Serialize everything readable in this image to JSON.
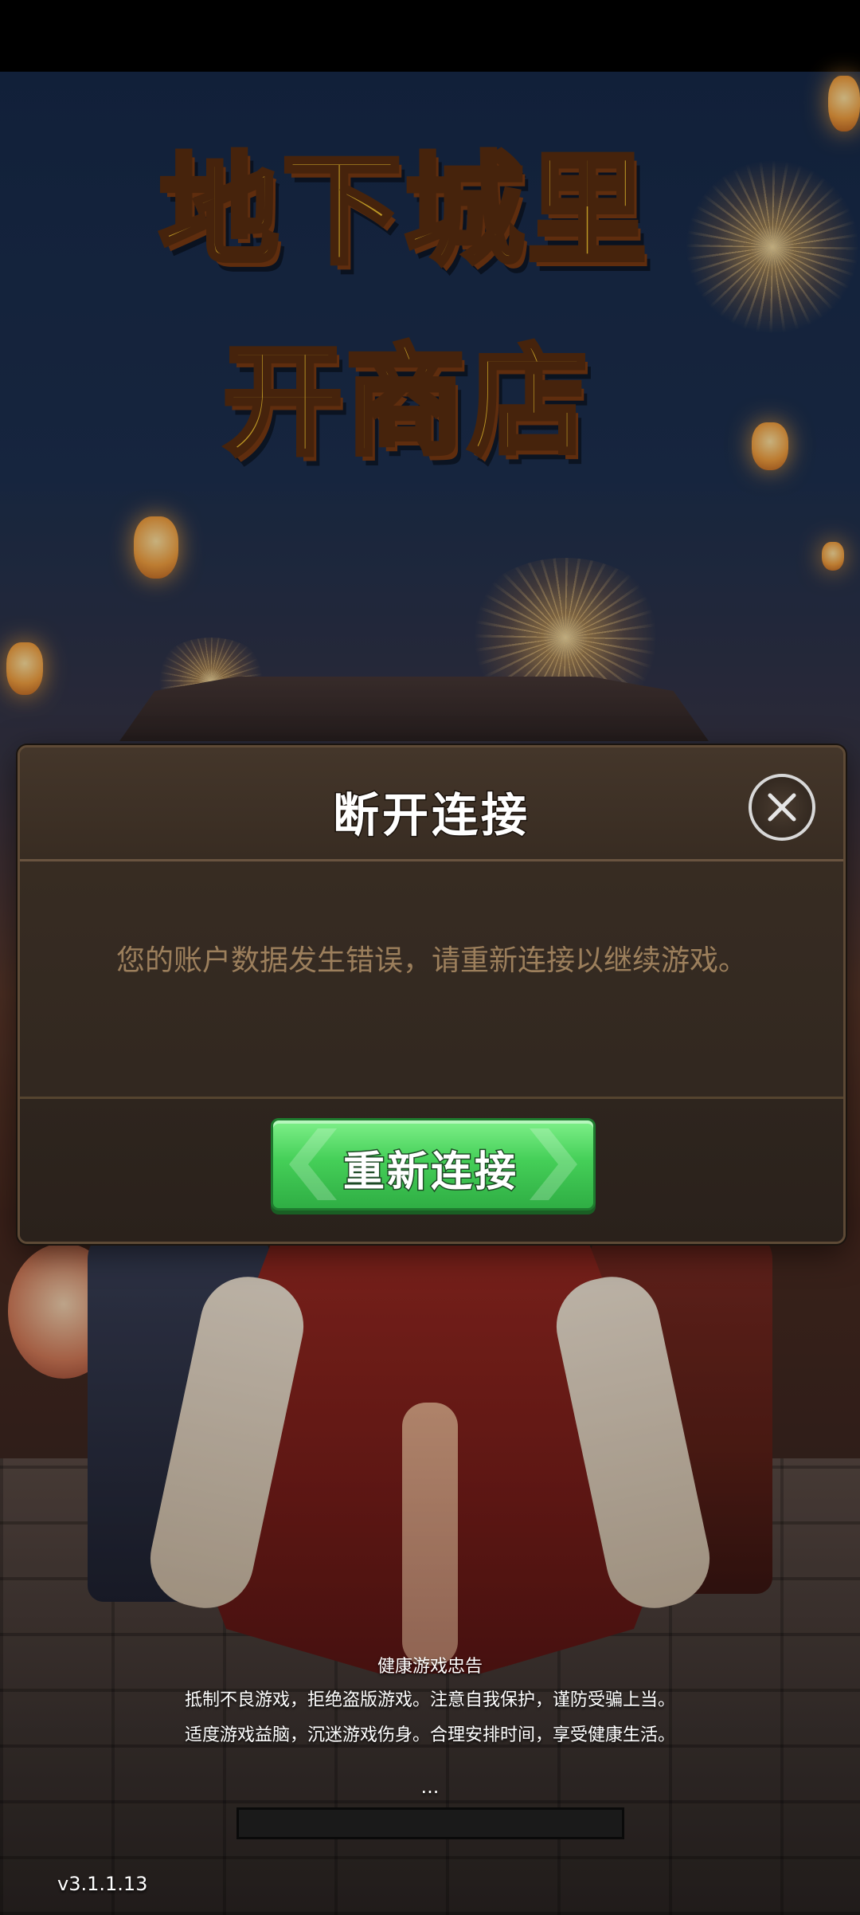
{
  "logo": {
    "line1": "地下城里",
    "line2": "开商店"
  },
  "dialog": {
    "title": "断开连接",
    "message": "您的账户数据发生错误，请重新连接以继续游戏。",
    "reconnect_label": "重新连接",
    "close_icon": "close-icon"
  },
  "notice": {
    "title": "健康游戏忠告",
    "line1": "抵制不良游戏，拒绝盗版游戏。注意自我保护，谨防受骗上当。",
    "line2": "适度游戏益脑，沉迷游戏伤身。合理安排时间，享受健康生活。"
  },
  "loading": {
    "dots": "...",
    "progress": 0
  },
  "version": "v3.1.1.13",
  "colors": {
    "dialog_bg": "#2e251e",
    "button_green": "#45cf58",
    "message_text": "#9c7f5c",
    "logo_gold": "#f4c430"
  }
}
